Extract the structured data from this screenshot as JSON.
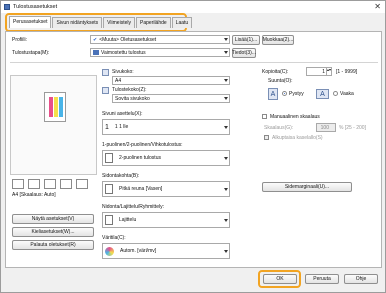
{
  "window": {
    "title": "Tulostusasetukset",
    "close_glyph": "✕"
  },
  "tabs": [
    "Perusasetukset",
    "Sivun nidäntyksets",
    "Viimeistely",
    "Paperilähde",
    "Laatu"
  ],
  "profile": {
    "label": "Profiili:",
    "value": "<Muuta> Oletusasetukset",
    "add_label": "Lisää(1)...",
    "edit_label": "Muokkaa(2)..."
  },
  "output": {
    "label": "Tulostustapa(M):",
    "value": "Vaimostettu tulostus",
    "details_label": "Tiedot(3)..."
  },
  "page_size": {
    "label": "Sivukoko:",
    "value": "A4"
  },
  "output_size": {
    "label": "Tulostekoko(Z):",
    "value": "Sovita sivukoko"
  },
  "copies": {
    "label": "Kopioita(C):",
    "value": "1",
    "range": "[1 - 9999]"
  },
  "orientation": {
    "label": "Suunta(O):",
    "portrait_label": "Pystyy",
    "landscape_label": "Vaaka"
  },
  "pages_per_sheet": {
    "label": "Sivuni asettelu(X):",
    "value": "1 1 lle"
  },
  "manual_scaling": {
    "label": "Manuaalinen skaalaus",
    "scale_label": "Skaalaus(G):",
    "scale_value": "100",
    "scale_range": "% [25 - 200]"
  },
  "bounding": {
    "label": "Alkuptaisa kaselallo(S)"
  },
  "duplex": {
    "label": "1-puolinen/2-puolinen/Vihkotulostus:",
    "value": "2-puolinen tulostus"
  },
  "binding": {
    "label": "Sidontakohta(B):",
    "value": "Pitkä reuna [Vasen]",
    "margin_label": "Sidemarginaali(U)..."
  },
  "collate": {
    "label": "Nidonta/Lajittelu/Ryhmittely:",
    "value": "Lajittelu"
  },
  "color": {
    "label": "Väritila(C):",
    "value": "Autom. [väri/mv]"
  },
  "preview": {
    "status": "A4 [Skaalaus: Auto]"
  },
  "left_buttons": [
    "Näytä asetukset(V)",
    "Kieliasetukset(W)...",
    "Palauta oletukset(R)"
  ],
  "footer": {
    "ok_label": "OK",
    "cancel_label": "Peruuta",
    "help_label": "Ohje"
  },
  "accent_color": "#f2a422"
}
